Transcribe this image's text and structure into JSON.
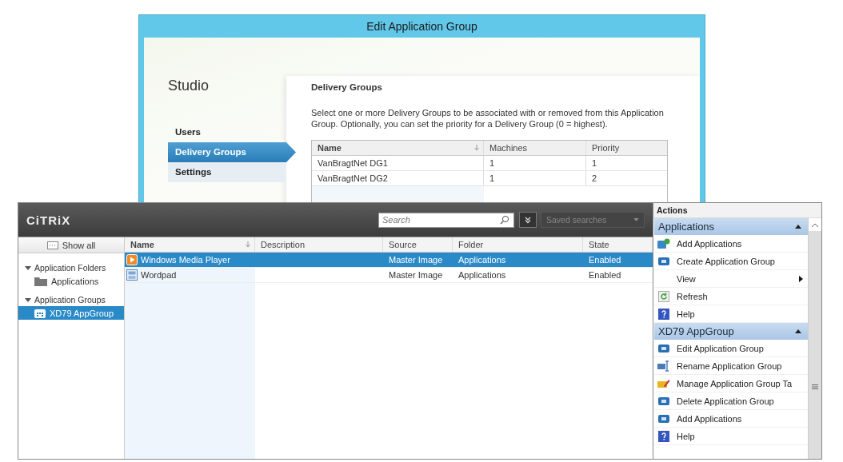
{
  "dialog": {
    "title": "Edit Application Group",
    "brand": "Studio",
    "nav": [
      {
        "label": "Users",
        "selected": false
      },
      {
        "label": "Delivery Groups",
        "selected": true
      },
      {
        "label": "Settings",
        "selected": false
      }
    ],
    "heading": "Delivery Groups",
    "description": "Select one or more Delivery Groups to be associated with or removed from this Application Group. Optionally, you can set the priority for a Delivery Group (0 = highest).",
    "table": {
      "columns": [
        "Name",
        "Machines",
        "Priority"
      ],
      "rows": [
        [
          "VanBragtNet DG1",
          "1",
          "1"
        ],
        [
          "VanBragtNet DG2",
          "1",
          "2"
        ]
      ]
    }
  },
  "console": {
    "logo": "CiTRiX",
    "search": {
      "placeholder": "Search"
    },
    "saved_searches": {
      "placeholder": "Saved searches"
    },
    "sidebar": {
      "show_all": "Show all",
      "tree": [
        {
          "label": "Application Folders",
          "expanded": true,
          "children": [
            {
              "label": "Applications",
              "kind": "folder",
              "selected": false
            }
          ]
        },
        {
          "label": "Application Groups",
          "expanded": true,
          "children": [
            {
              "label": "XD79 AppGroup",
              "kind": "group",
              "selected": true
            }
          ]
        }
      ]
    },
    "table": {
      "columns": [
        "Name",
        "Description",
        "Source",
        "Folder",
        "State"
      ],
      "rows": [
        {
          "kind": "media",
          "cells": [
            "Windows Media Player",
            "",
            "Master Image",
            "Applications",
            "Enabled"
          ],
          "selected": true
        },
        {
          "kind": "wordpad",
          "cells": [
            "Wordpad",
            "",
            "Master Image",
            "Applications",
            "Enabled"
          ],
          "selected": false
        }
      ]
    }
  },
  "actions": {
    "title": "Actions",
    "sections": [
      {
        "title": "Applications",
        "expanded": true,
        "items": [
          {
            "label": "Add Applications",
            "kind": "add"
          },
          {
            "label": "Create Application Group",
            "kind": "group"
          },
          {
            "label": "View",
            "kind": "submenu"
          },
          {
            "label": "Refresh",
            "kind": "refresh"
          },
          {
            "label": "Help",
            "kind": "help"
          }
        ]
      },
      {
        "title": "XD79 AppGroup",
        "expanded": true,
        "items": [
          {
            "label": "Edit Application Group",
            "kind": "edit"
          },
          {
            "label": "Rename Application Group",
            "kind": "rename"
          },
          {
            "label": "Manage Application Group Ta",
            "kind": "tag"
          },
          {
            "label": "Delete Application Group",
            "kind": "delete"
          },
          {
            "label": "Add Applications",
            "kind": "addgroup"
          },
          {
            "label": "Help",
            "kind": "help"
          }
        ]
      }
    ]
  }
}
